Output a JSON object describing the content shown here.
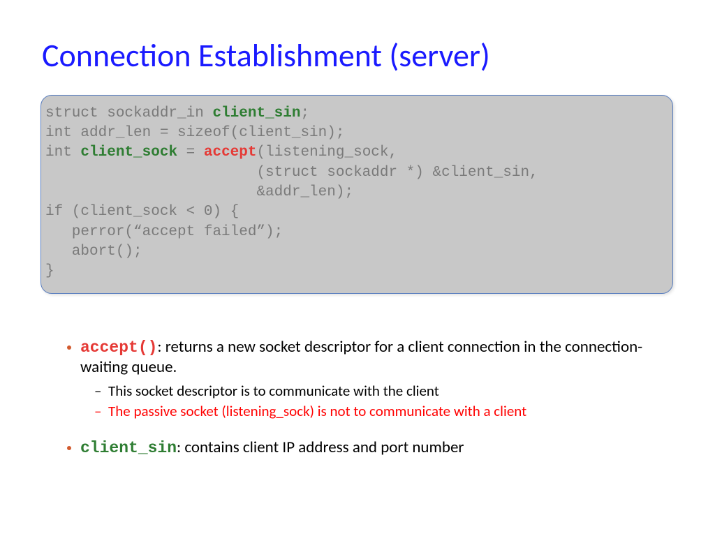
{
  "title": "Connection Establishment (server)",
  "code": {
    "l1a": "struct sockaddr_in ",
    "l1b": "client_sin",
    "l1c": ";",
    "l2": "int addr_len = sizeof(client_sin);",
    "l3a": "int ",
    "l3b": "client_sock",
    "l3c": " = ",
    "l3d": "accept",
    "l3e": "(listening_sock,",
    "l4": "                        (struct sockaddr *) &client_sin,",
    "l5": "                        &addr_len);",
    "l6": "if (client_sock < 0) {",
    "l7": "   perror(“accept failed”);",
    "l8": "   abort();",
    "l9": "}"
  },
  "bullets": {
    "b1_code": "accept()",
    "b1_text": ": returns a new socket descriptor for a client connection in the connection-waiting queue.",
    "b1_sub1": "This socket descriptor is to communicate with the client",
    "b1_sub2": "The passive socket (listening_sock) is not to communicate with a client",
    "b2_code": "client_sin",
    "b2_text": ": contains client IP address and port number"
  }
}
